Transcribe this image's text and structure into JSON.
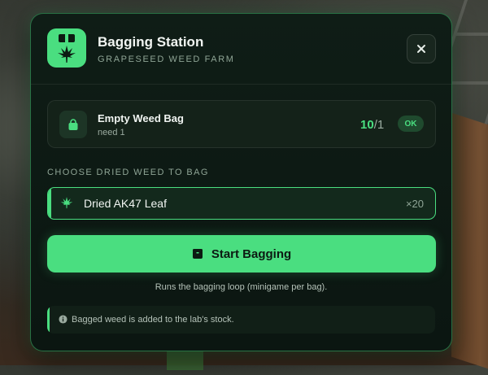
{
  "window": {
    "title": "Bagging Station",
    "subtitle": "GRAPESEED WEED FARM",
    "close_label": "×"
  },
  "requirement": {
    "name": "Empty Weed Bag",
    "need_text": "need 1",
    "have": "10",
    "need": "/1",
    "status": "OK"
  },
  "selection": {
    "section_label": "CHOOSE DRIED WEED TO BAG",
    "options": [
      {
        "name": "Dried AK47 Leaf",
        "quantity": "×20",
        "selected": true
      }
    ]
  },
  "action": {
    "start_label": "Start Bagging",
    "hint": "Runs the bagging loop (minigame per bag)."
  },
  "info": {
    "text": "Bagged weed is added to the lab's stock."
  },
  "icons": {
    "app": "bag-with-leaf-icon",
    "requirement": "shopping-bag-icon",
    "option": "cannabis-leaf-icon",
    "start": "box-icon",
    "info": "info-circle-icon",
    "close": "close-icon"
  },
  "colors": {
    "accent": "#4ade80",
    "panel_bg": "#0f1d16",
    "text_primary": "#f1f5f2",
    "text_muted": "#8fa596"
  }
}
